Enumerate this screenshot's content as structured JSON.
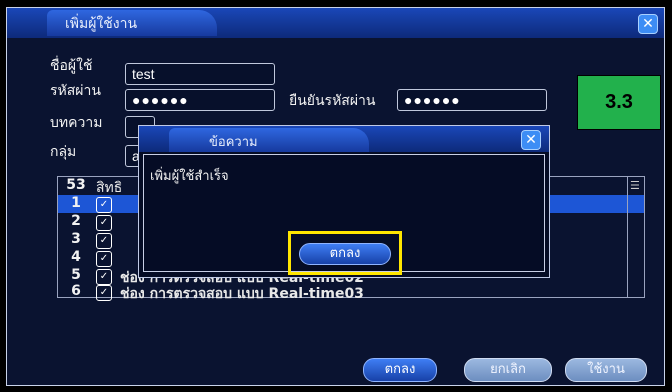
{
  "window": {
    "title": "เพิ่มผู้ใช้งาน",
    "close_icon": "close-icon"
  },
  "form": {
    "username_label": "ชื่อผู้ใช้",
    "username_value": "test",
    "password_label": "รหัสผ่าน",
    "password_value": "●●●●●●",
    "confirm_label": "ยืนยันรหัสผ่าน",
    "confirm_value": "●●●●●●",
    "note_label": "บทความ",
    "group_label": "กลุ่ม",
    "group_value": "a"
  },
  "rights_list": {
    "count": "53",
    "header": "สิทธิ",
    "rows": [
      {
        "num": "1",
        "text": ""
      },
      {
        "num": "2",
        "text": ""
      },
      {
        "num": "3",
        "text": ""
      },
      {
        "num": "4",
        "text": ""
      },
      {
        "num": "5",
        "text": "ช่อง การตรวจสอบ แบบ Real-time02"
      },
      {
        "num": "6",
        "text": "ช่อง การตรวจสอบ แบบ Real-time03"
      }
    ]
  },
  "buttons": {
    "ok": "ตกลง",
    "cancel": "ยกเลิก",
    "apply": "ใช้งาน"
  },
  "dialog": {
    "title": "ข้อความ",
    "message": "เพิ่มผู้ใช้สำเร็จ",
    "ok": "ตกลง"
  },
  "badge": "3.3",
  "colors": {
    "highlight": "#ffe600",
    "badge": "#22b14c",
    "accent": "#1d56d6"
  }
}
